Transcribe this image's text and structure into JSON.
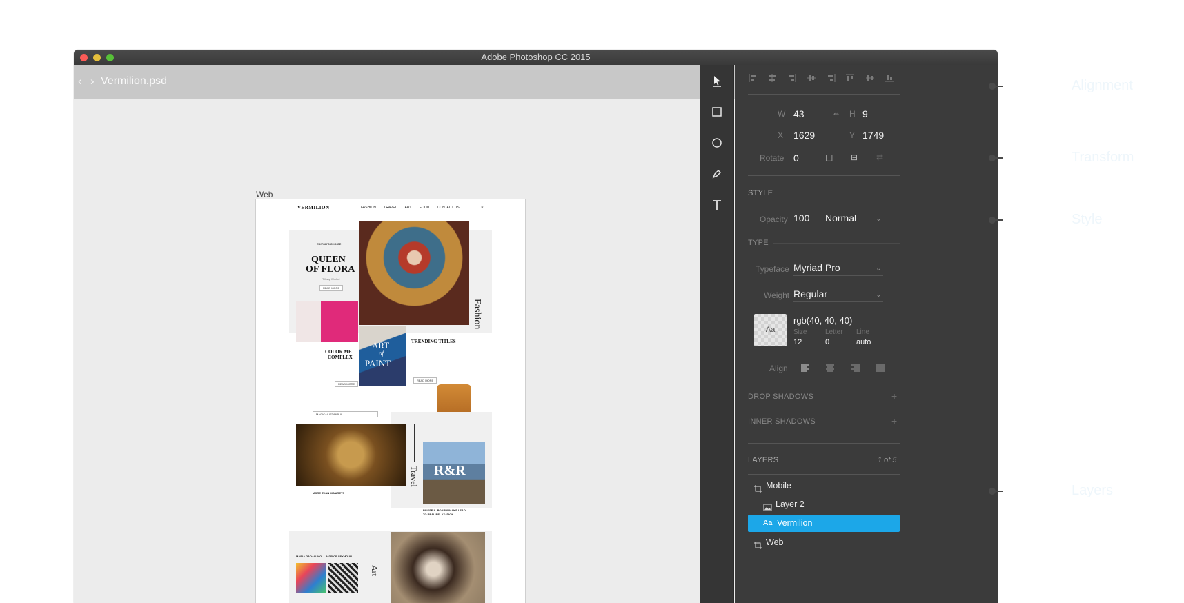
{
  "window": {
    "title": "Adobe Photoshop CC 2015",
    "filename": "Vermilion.psd",
    "nav_back": "‹",
    "nav_forward": "›"
  },
  "canvas": {
    "artboard_label": "Web",
    "site": {
      "logo": "VERMILION",
      "nav": [
        "FASHION",
        "TRAVEL",
        "ART",
        "FOOD",
        "CONTACT US"
      ],
      "editors_choice": "EDITOR'S CHOICE",
      "headline_1": "QUEEN",
      "headline_2": "OF FLORA",
      "byline": "Tiffany Warhol",
      "read_more": "READ MORE",
      "fashion_label": "Fashion",
      "color_title_1": "COLOR ME",
      "color_title_2": "COMPLEX",
      "art_paint_1": "ART",
      "art_paint_2": "of",
      "art_paint_3": "PAINT",
      "trending": "TRENDING TITLES",
      "dropdown": "MAGICAL ISTANBUL",
      "travel_label": "Travel",
      "rr": "R&R",
      "minarets": "MORE THAN MINARETS",
      "boardwalks_1": "BLISSFUL BOARDWALKS LEAD",
      "boardwalks_2": "TO REAL RELAXATION",
      "names": "MARIA GADALUNO     PATRICE SEYMOUR",
      "art_label": "Art"
    }
  },
  "panel": {
    "W": "43",
    "H": "9",
    "X": "1629",
    "Y": "1749",
    "Rotate": "0",
    "labels": {
      "w": "W",
      "h": "H",
      "x": "X",
      "y": "Y",
      "rotate": "Rotate",
      "opacity": "Opacity",
      "typeface": "Typeface",
      "weight": "Weight",
      "align": "Align",
      "size": "Size",
      "letter": "Letter",
      "line": "Line"
    },
    "style_header": "STYLE",
    "opacity": "100",
    "blend": "Normal",
    "type_header": "TYPE",
    "typeface": "Myriad Pro",
    "weight": "Regular",
    "swatch_text": "Aa",
    "color": "rgb(40, 40, 40)",
    "size": "12",
    "letter": "0",
    "line": "auto",
    "drop_shadows": "DROP SHADOWS",
    "inner_shadows": "INNER SHADOWS",
    "layers_header": "LAYERS",
    "layers_count": "1 of 5",
    "layers": [
      {
        "name": "Mobile",
        "icon": "artboard-icon"
      },
      {
        "name": "Layer 2",
        "icon": "image-icon"
      },
      {
        "name": "Vermilion",
        "icon": "text-icon",
        "selected": true
      },
      {
        "name": "Web",
        "icon": "artboard-icon"
      }
    ],
    "accent": "#1ca7e8"
  },
  "callouts": [
    "Alignment",
    "Transform",
    "Style",
    "Layers"
  ]
}
